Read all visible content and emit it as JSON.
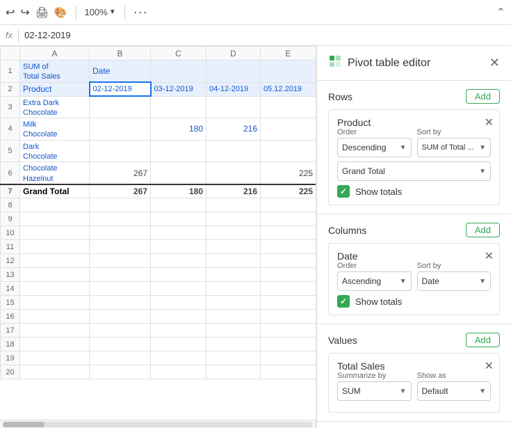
{
  "toolbar": {
    "undo_icon": "↩",
    "redo_icon": "↪",
    "print_icon": "🖨",
    "format_icon": "⊞",
    "zoom": "100%",
    "more_icon": "•••",
    "collapse_icon": "⌃"
  },
  "formula_bar": {
    "fx_label": "fx",
    "cell_value": "02-12-2019"
  },
  "grid": {
    "col_headers": [
      "",
      "A",
      "B",
      "C",
      "D",
      "E"
    ],
    "rows": [
      {
        "num": "1",
        "a": "SUM of Total Sales",
        "b": "Date",
        "c": "",
        "d": "",
        "e": ""
      },
      {
        "num": "2",
        "a": "Product",
        "b": "02-12-2019",
        "c": "03-12-2019",
        "d": "04-12-2019",
        "e": "05.12.2019"
      },
      {
        "num": "3",
        "a": "Extra Dark Chocolate",
        "b": "",
        "c": "",
        "d": "",
        "e": ""
      },
      {
        "num": "4",
        "a": "Milk Chocolate",
        "b": "",
        "c": "180",
        "d": "216",
        "e": ""
      },
      {
        "num": "5",
        "a": "Dark Chocolate",
        "b": "",
        "c": "",
        "d": "",
        "e": ""
      },
      {
        "num": "6",
        "a": "Chocolate Hazelnut",
        "b": "267",
        "c": "",
        "d": "",
        "e": "225"
      },
      {
        "num": "7",
        "a": "Grand Total",
        "b": "267",
        "c": "180",
        "d": "216",
        "e": "225"
      },
      {
        "num": "8",
        "a": "",
        "b": "",
        "c": "",
        "d": "",
        "e": ""
      },
      {
        "num": "9",
        "a": "",
        "b": "",
        "c": "",
        "d": "",
        "e": ""
      },
      {
        "num": "10",
        "a": "",
        "b": "",
        "c": "",
        "d": "",
        "e": ""
      },
      {
        "num": "11",
        "a": "",
        "b": "",
        "c": "",
        "d": "",
        "e": ""
      },
      {
        "num": "12",
        "a": "",
        "b": "",
        "c": "",
        "d": "",
        "e": ""
      },
      {
        "num": "13",
        "a": "",
        "b": "",
        "c": "",
        "d": "",
        "e": ""
      },
      {
        "num": "14",
        "a": "",
        "b": "",
        "c": "",
        "d": "",
        "e": ""
      },
      {
        "num": "15",
        "a": "",
        "b": "",
        "c": "",
        "d": "",
        "e": ""
      },
      {
        "num": "16",
        "a": "",
        "b": "",
        "c": "",
        "d": "",
        "e": ""
      },
      {
        "num": "17",
        "a": "",
        "b": "",
        "c": "",
        "d": "",
        "e": ""
      },
      {
        "num": "18",
        "a": "",
        "b": "",
        "c": "",
        "d": "",
        "e": ""
      },
      {
        "num": "19",
        "a": "",
        "b": "",
        "c": "",
        "d": "",
        "e": ""
      },
      {
        "num": "20",
        "a": "",
        "b": "",
        "c": "",
        "d": "",
        "e": ""
      }
    ]
  },
  "pivot_editor": {
    "title": "Pivot table editor",
    "close_label": "✕",
    "rows_section": {
      "label": "Rows",
      "add_label": "Add",
      "card": {
        "title": "Product",
        "close": "✕",
        "order_label": "Order",
        "order_value": "Descending",
        "sort_by_label": "Sort by",
        "sort_by_value": "SUM of Total ...",
        "grand_total_value": "Grand Total",
        "show_totals_label": "Show totals"
      }
    },
    "columns_section": {
      "label": "Columns",
      "add_label": "Add",
      "card": {
        "title": "Date",
        "close": "✕",
        "order_label": "Order",
        "order_value": "Ascending",
        "sort_by_label": "Sort by",
        "sort_by_value": "Date",
        "show_totals_label": "Show totals"
      }
    },
    "values_section": {
      "label": "Values",
      "add_label": "Add",
      "card": {
        "title": "Total Sales",
        "close": "✕",
        "summarize_by_label": "Summarize by",
        "summarize_by_value": "SUM",
        "show_as_label": "Show as",
        "show_as_value": "Default"
      }
    }
  }
}
